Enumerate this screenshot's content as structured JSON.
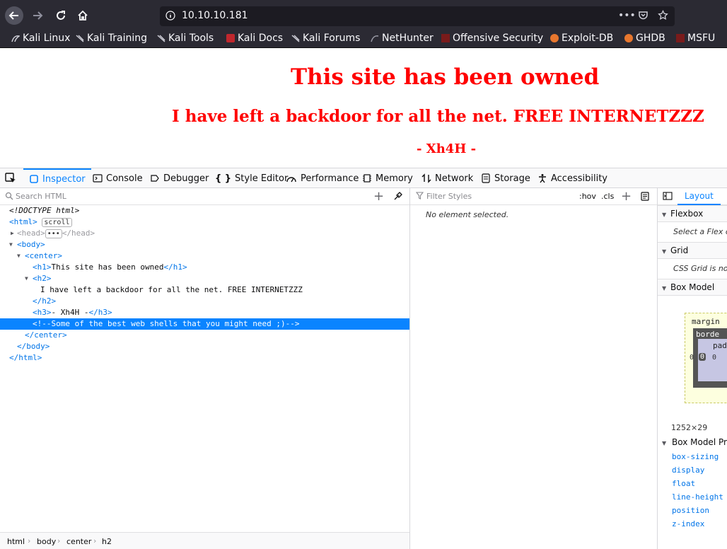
{
  "browser": {
    "url": "10.10.10.181",
    "bookmarks": [
      "Kali Linux",
      "Kali Training",
      "Kali Tools",
      "Kali Docs",
      "Kali Forums",
      "NetHunter",
      "Offensive Security",
      "Exploit-DB",
      "GHDB",
      "MSFU"
    ]
  },
  "page": {
    "h1": "This site has been owned",
    "h2": "I have left a backdoor for all the net. FREE INTERNETZZZ",
    "h3": "- Xh4H -"
  },
  "devtools": {
    "tabs": [
      "Inspector",
      "Console",
      "Debugger",
      "Style Editor",
      "Performance",
      "Memory",
      "Network",
      "Storage",
      "Accessibility"
    ],
    "search_placeholder": "Search HTML",
    "tree": {
      "doctype": "<!DOCTYPE html>",
      "html_badge": "scroll",
      "h1_text": "This site has been owned",
      "h2_text": "I have left a backdoor for all the net. FREE INTERNETZZZ",
      "h3_text": "- Xh4H -",
      "comment": "<!--Some of the best web shells that you might need ;)-->"
    },
    "breadcrumbs": [
      "html",
      "body",
      "center",
      "h2"
    ],
    "rules": {
      "filter_placeholder": "Filter Styles",
      "hov": ":hov",
      "cls": ".cls",
      "empty": "No element selected."
    },
    "layout": {
      "tab": "Layout",
      "flexbox_title": "Flexbox",
      "flexbox_msg": "Select a Flex c",
      "grid_title": "Grid",
      "grid_msg": "CSS Grid is no",
      "boxmodel_title": "Box Model",
      "margin_label": "margin",
      "border_label": "borde",
      "padding_label": "pad",
      "zeros": "0",
      "dimensions": "1252×29",
      "boxprops_title": "Box Model Pro",
      "props": [
        "box-sizing",
        "display",
        "float",
        "line-height",
        "position",
        "z-index"
      ]
    }
  }
}
